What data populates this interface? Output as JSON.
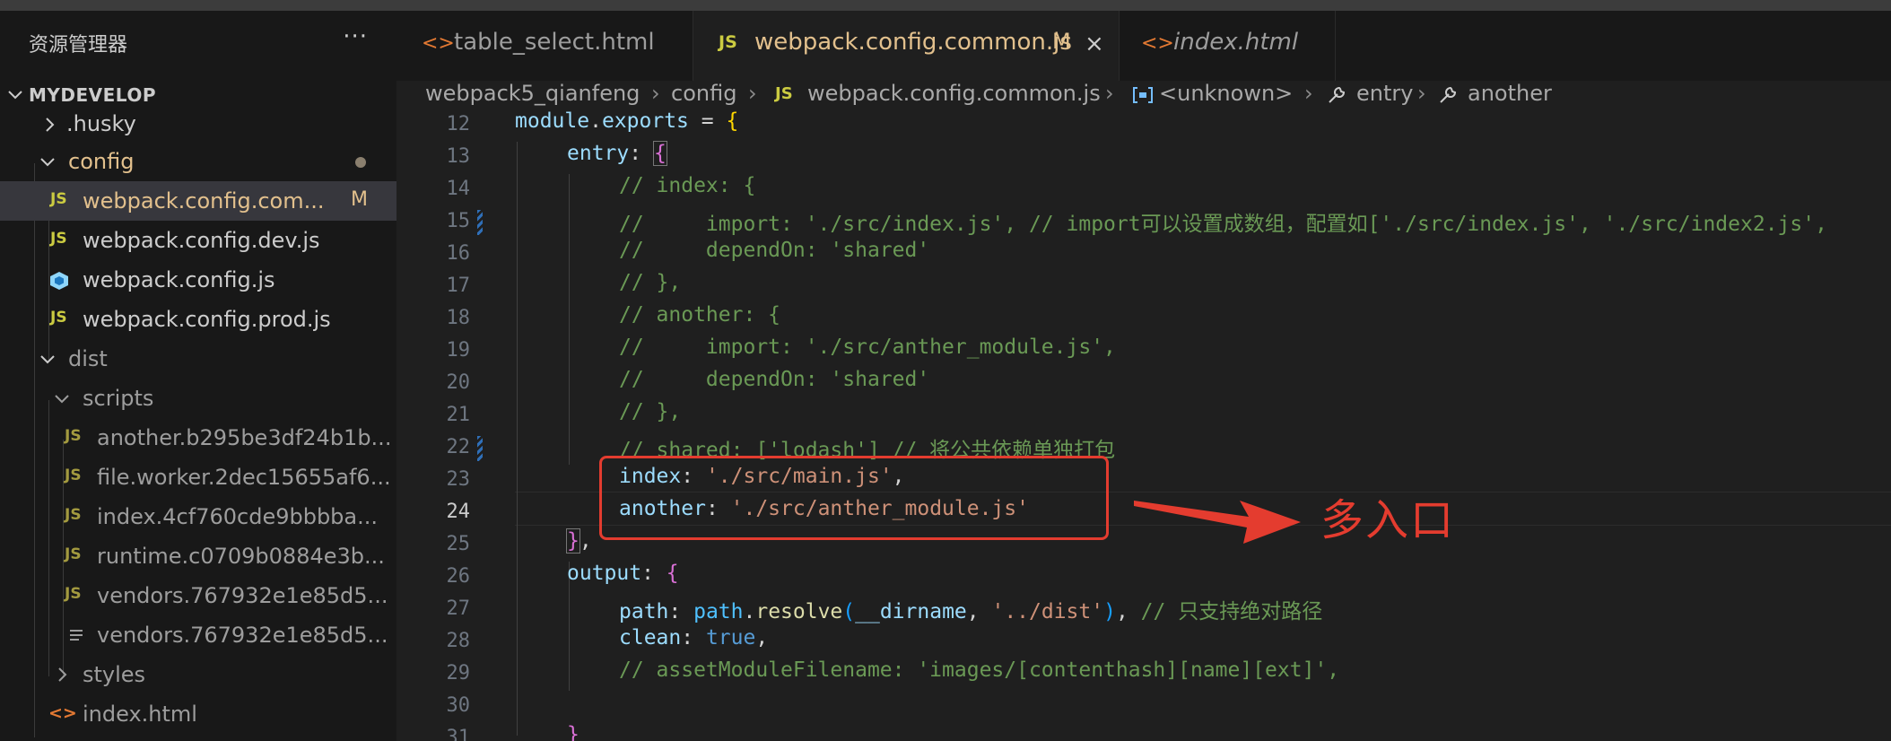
{
  "sidebar": {
    "title": "资源管理器",
    "more": "···",
    "section": "MYDEVELOP",
    "items": [
      {
        "label": ".husky",
        "icon": "chevron-right-icon"
      },
      {
        "label": "config",
        "icon": "chevron-down-icon"
      },
      {
        "label": "webpack.config.com...",
        "badge": "M",
        "icon": "js-file-icon"
      },
      {
        "label": "webpack.config.dev.js",
        "icon": "js-file-icon"
      },
      {
        "label": "webpack.config.js",
        "icon": "webpack-cube-icon"
      },
      {
        "label": "webpack.config.prod.js",
        "icon": "js-file-icon"
      },
      {
        "label": "dist",
        "icon": "chevron-down-icon"
      },
      {
        "label": "scripts",
        "icon": "chevron-down-icon"
      },
      {
        "label": "another.b295be3df24b1b...",
        "icon": "js-file-icon"
      },
      {
        "label": "file.worker.2dec15655af6...",
        "icon": "js-file-icon"
      },
      {
        "label": "index.4cf760cde9bbbba...",
        "icon": "js-file-icon"
      },
      {
        "label": "runtime.c0709b0884e3b...",
        "icon": "js-file-icon"
      },
      {
        "label": "vendors.767932e1e85d5...",
        "icon": "js-file-icon"
      },
      {
        "label": "vendors.767932e1e85d5...",
        "icon": "lines-file-icon"
      },
      {
        "label": "styles",
        "icon": "chevron-right-icon"
      },
      {
        "label": "index.html",
        "icon": "html-file-icon"
      }
    ]
  },
  "tabs": [
    {
      "icon": "<>",
      "label": "table_select.html"
    },
    {
      "icon": "JS",
      "label": "webpack.config.common.js",
      "status": "M",
      "close": "×"
    },
    {
      "icon": "<>",
      "label": "index.html"
    }
  ],
  "breadcrumb": [
    "webpack5_qianfeng",
    "config",
    "JS",
    "webpack.config.common.js",
    "<unknown>",
    "entry",
    "another"
  ],
  "editor": {
    "line_numbers": [
      "12",
      "13",
      "14",
      "15",
      "16",
      "17",
      "18",
      "19",
      "20",
      "21",
      "22",
      "23",
      "24",
      "25",
      "26",
      "27",
      "28",
      "29",
      "30",
      "31"
    ],
    "current_line": "24",
    "lines": {
      "l12": [
        "module",
        ".",
        "exports",
        " = ",
        "{"
      ],
      "l13": [
        "entry",
        ": ",
        "{"
      ],
      "l14": "// index: {",
      "l15": "//     import: './src/index.js', // import可以设置成数组，配置如['./src/index.js', './src/index2.js',",
      "l16": "//     dependOn: 'shared'",
      "l17": "// },",
      "l18": "// another: {",
      "l19": "//     import: './src/anther_module.js',",
      "l20": "//     dependOn: 'shared'",
      "l21": "// },",
      "l22": "// shared: ['lodash'] // 将公共依赖单独打包",
      "l23": [
        "index",
        ": ",
        "'./src/main.js'",
        ","
      ],
      "l24": [
        "another",
        ": ",
        "'./src/anther_module.js'"
      ],
      "l25": [
        "}",
        ","
      ],
      "l26": [
        "output",
        ": ",
        "{"
      ],
      "l27": [
        "path",
        ": ",
        "path",
        ".",
        "resolve",
        "(",
        "__dirname",
        ", ",
        "'../dist'",
        ")",
        ", ",
        "// 只支持绝对路径"
      ],
      "l28": [
        "clean",
        ": ",
        "true",
        ","
      ],
      "l29": "// assetModuleFilename: 'images/[contenthash][name][ext]',",
      "l31": "}"
    }
  },
  "annotation": {
    "text": "多入口",
    "color": "#e43c2f"
  }
}
